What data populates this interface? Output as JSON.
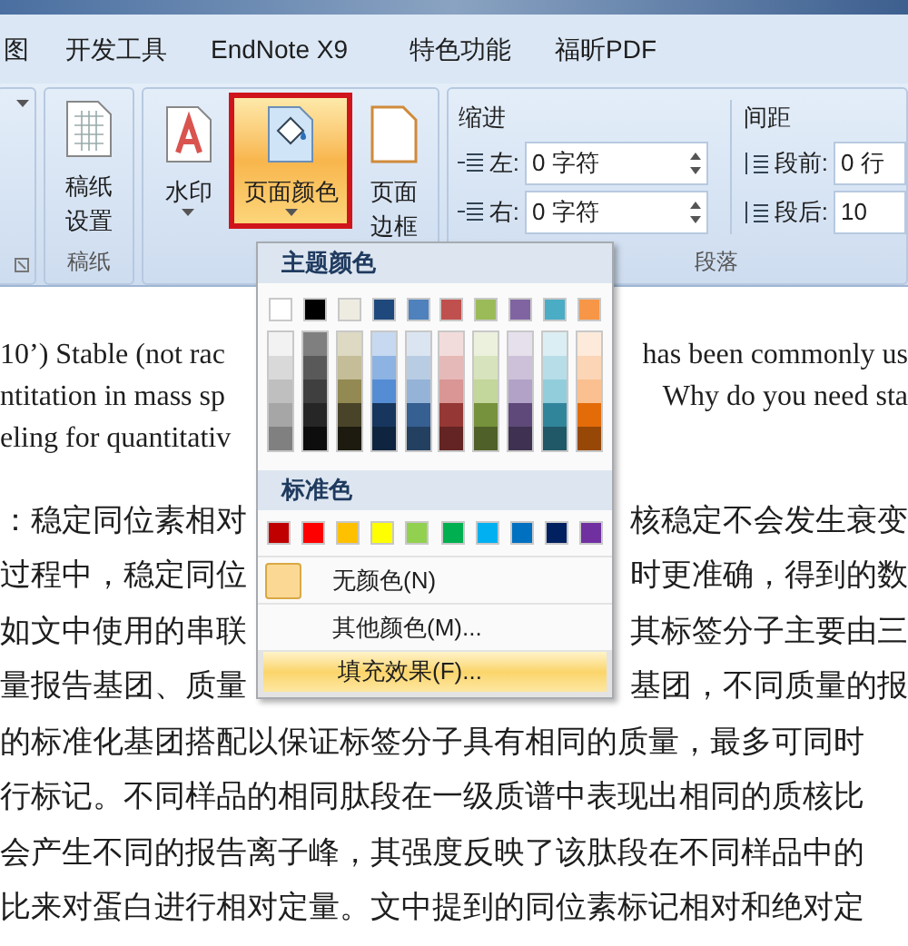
{
  "tabs": [
    {
      "label": "图",
      "selected": false
    },
    {
      "label": "开发工具",
      "selected": false
    },
    {
      "label": "EndNote X9",
      "selected": false
    },
    {
      "label": "特色功能",
      "selected": false
    },
    {
      "label": "福昕PDF",
      "selected": false
    }
  ],
  "ribbon": {
    "paper_group": {
      "button": [
        "稿纸",
        "设置"
      ],
      "label": "稿纸"
    },
    "background_group": {
      "buttons": [
        {
          "kind": "watermark",
          "label": [
            "水印"
          ],
          "pressed": false,
          "outlined": false
        },
        {
          "kind": "page_color",
          "label": [
            "页面颜色"
          ],
          "pressed": true,
          "outlined": true
        },
        {
          "kind": "page_border",
          "label": [
            "页面",
            "边框"
          ],
          "pressed": false,
          "outlined": false
        }
      ]
    },
    "paragraph_group": {
      "indent_title": "缩进",
      "indent_fields": [
        {
          "label": "左:",
          "value": "0 字符"
        },
        {
          "label": "右:",
          "value": "0 字符"
        }
      ],
      "spacing_title": "间距",
      "spacing_fields": [
        {
          "label": "段前:",
          "value": "0 行"
        },
        {
          "label": "段后:",
          "value": "10"
        }
      ],
      "label": "段落"
    }
  },
  "menu": {
    "theme_title": "主题颜色",
    "theme_columns": [
      {
        "color": "#ffffff",
        "shades": [
          {
            "color": "#f2f2f2"
          },
          {
            "color": "#d9d9d9"
          },
          {
            "color": "#bfbfbf"
          },
          {
            "color": "#a6a6a6"
          },
          {
            "color": "#808080"
          }
        ]
      },
      {
        "color": "#000000",
        "shades": [
          {
            "color": "#7f7f7f"
          },
          {
            "color": "#595959"
          },
          {
            "color": "#3f3f3f"
          },
          {
            "color": "#262626"
          },
          {
            "color": "#0d0d0d"
          }
        ]
      },
      {
        "color": "#eeece1",
        "shades": [
          {
            "color": "#ddd9c3"
          },
          {
            "color": "#c4bd97"
          },
          {
            "color": "#938953"
          },
          {
            "color": "#494429"
          },
          {
            "color": "#1d1b10"
          }
        ]
      },
      {
        "color": "#1f497d",
        "shades": [
          {
            "color": "#c6d9f0"
          },
          {
            "color": "#8db3e2"
          },
          {
            "color": "#548dd4"
          },
          {
            "color": "#17365d"
          },
          {
            "color": "#0f243e"
          }
        ]
      },
      {
        "color": "#4f81bd",
        "shades": [
          {
            "color": "#dbe5f1"
          },
          {
            "color": "#b8cce4"
          },
          {
            "color": "#95b3d7"
          },
          {
            "color": "#366092"
          },
          {
            "color": "#244061"
          }
        ]
      },
      {
        "color": "#c0504d",
        "shades": [
          {
            "color": "#f2dcdb"
          },
          {
            "color": "#e5b9b7"
          },
          {
            "color": "#d99694"
          },
          {
            "color": "#953734"
          },
          {
            "color": "#632423"
          }
        ]
      },
      {
        "color": "#9bbb59",
        "shades": [
          {
            "color": "#ebf1dd"
          },
          {
            "color": "#d7e3bc"
          },
          {
            "color": "#c3d69b"
          },
          {
            "color": "#76923c"
          },
          {
            "color": "#4f6128"
          }
        ]
      },
      {
        "color": "#8064a2",
        "shades": [
          {
            "color": "#e5e0ec"
          },
          {
            "color": "#ccc1d9"
          },
          {
            "color": "#b2a2c7"
          },
          {
            "color": "#5f497a"
          },
          {
            "color": "#3f3151"
          }
        ]
      },
      {
        "color": "#4bacc6",
        "shades": [
          {
            "color": "#dbeef3"
          },
          {
            "color": "#b7dde8"
          },
          {
            "color": "#92cddc"
          },
          {
            "color": "#31859b"
          },
          {
            "color": "#205867"
          }
        ]
      },
      {
        "color": "#f79646",
        "shades": [
          {
            "color": "#fdeada"
          },
          {
            "color": "#fbd5b5"
          },
          {
            "color": "#fac08f"
          },
          {
            "color": "#e36c09"
          },
          {
            "color": "#974806"
          }
        ]
      }
    ],
    "standard_title": "标准色",
    "standard_colors": [
      {
        "color": "#c00000"
      },
      {
        "color": "#ff0000"
      },
      {
        "color": "#ffc000"
      },
      {
        "color": "#ffff00"
      },
      {
        "color": "#92d050"
      },
      {
        "color": "#00b050"
      },
      {
        "color": "#00b0f0"
      },
      {
        "color": "#0070c0"
      },
      {
        "color": "#002060"
      },
      {
        "color": "#7030a0"
      }
    ],
    "items": [
      {
        "kind": "swatch",
        "label": "无颜色(N)",
        "selected": false,
        "outlined": false
      },
      {
        "kind": "plain",
        "label": "其他颜色(M)...",
        "selected": false,
        "outlined": false
      },
      {
        "kind": "plain",
        "label": "填充效果(F)...",
        "selected": true,
        "outlined": true
      }
    ]
  },
  "document": {
    "english_lines": [
      {
        "left": "10’) Stable (not rac",
        "right": "has been commonly us"
      },
      {
        "left": "ntitation in mass sp",
        "right": "Why do you need sta"
      },
      {
        "left": "eling for quantitativ"
      }
    ],
    "chinese_lines": [
      {
        "left": "：稳定同位素相对",
        "right": "核稳定不会发生衰变"
      },
      {
        "left": "过程中，稳定同位",
        "right": "时更准确，得到的数"
      },
      {
        "left": "如文中使用的串联",
        "right": "其标签分子主要由三"
      },
      {
        "left": "量报告基团、质量",
        "right": "基团，不同质量的报"
      },
      {
        "left": "的标准化基团搭配以保证标签分子具有相同的质量，最多可同时"
      },
      {
        "left": "行标记。不同样品的相同肽段在一级质谱中表现出相同的质核比"
      },
      {
        "left": "会产生不同的报告离子峰，其强度反映了该肽段在不同样品中的"
      },
      {
        "left": "比来对蛋白进行相对定量。文中提到的同位素标记相对和绝对定"
      }
    ]
  }
}
